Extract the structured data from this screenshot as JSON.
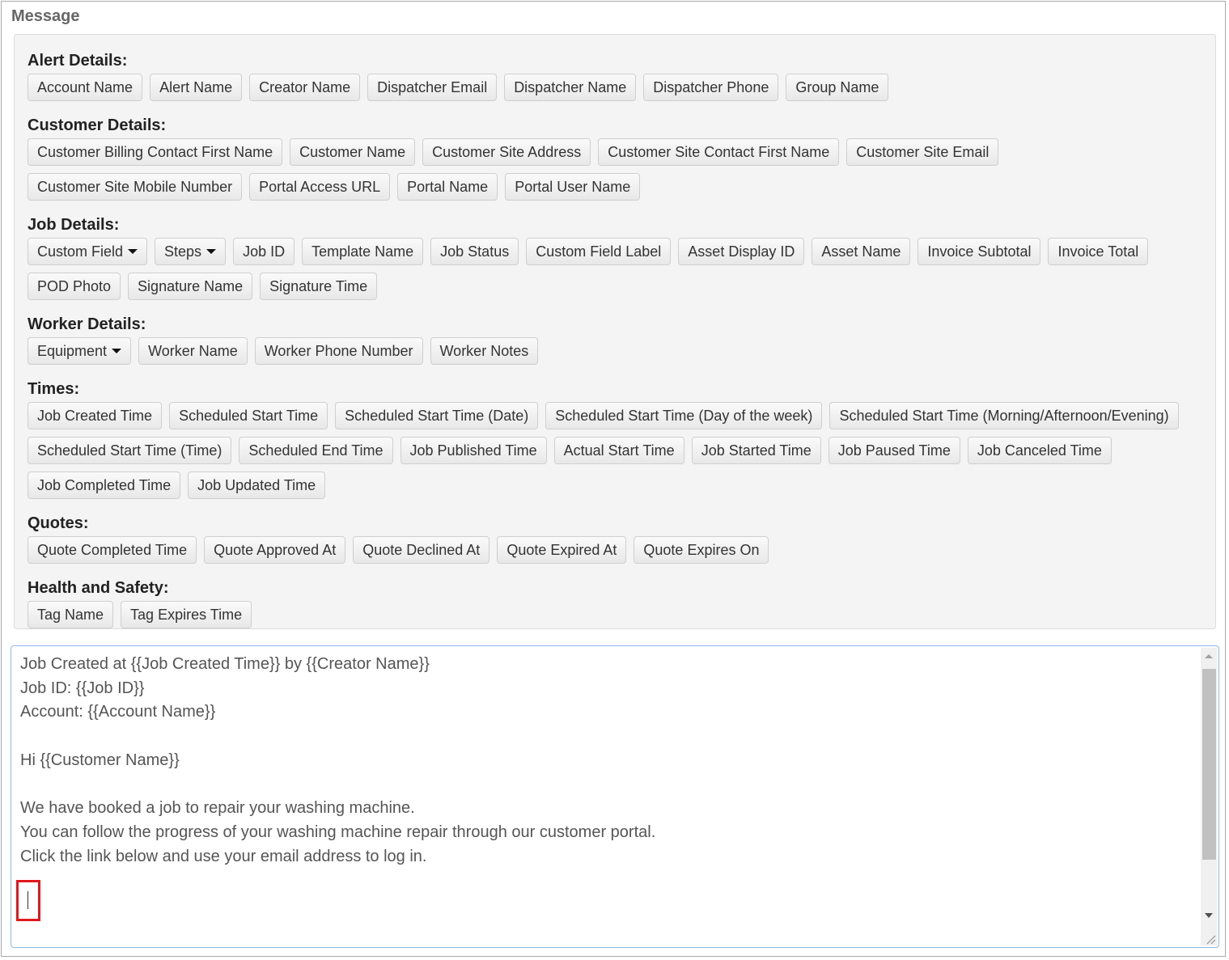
{
  "message_label": "Message",
  "sections": [
    {
      "title": "Alert Details:",
      "rows": [
        [
          {
            "label": "Account Name"
          },
          {
            "label": "Alert Name"
          },
          {
            "label": "Creator Name"
          },
          {
            "label": "Dispatcher Email"
          },
          {
            "label": "Dispatcher Name"
          },
          {
            "label": "Dispatcher Phone"
          },
          {
            "label": "Group Name"
          }
        ]
      ]
    },
    {
      "title": "Customer Details:",
      "rows": [
        [
          {
            "label": "Customer Billing Contact First Name"
          },
          {
            "label": "Customer Name"
          },
          {
            "label": "Customer Site Address"
          },
          {
            "label": "Customer Site Contact First Name"
          },
          {
            "label": "Customer Site Email"
          }
        ],
        [
          {
            "label": "Customer Site Mobile Number"
          },
          {
            "label": "Portal Access URL"
          },
          {
            "label": "Portal Name"
          },
          {
            "label": "Portal User Name"
          }
        ]
      ]
    },
    {
      "title": "Job Details:",
      "rows": [
        [
          {
            "label": "Custom Field",
            "dropdown": true
          },
          {
            "label": "Steps",
            "dropdown": true
          },
          {
            "label": "Job ID"
          },
          {
            "label": "Template Name"
          },
          {
            "label": "Job Status"
          },
          {
            "label": "Custom Field Label"
          },
          {
            "label": "Asset Display ID"
          },
          {
            "label": "Asset Name"
          },
          {
            "label": "Invoice Subtotal"
          },
          {
            "label": "Invoice Total"
          }
        ],
        [
          {
            "label": "POD Photo"
          },
          {
            "label": "Signature Name"
          },
          {
            "label": "Signature Time"
          }
        ]
      ]
    },
    {
      "title": "Worker Details:",
      "rows": [
        [
          {
            "label": "Equipment",
            "dropdown": true
          },
          {
            "label": "Worker Name"
          },
          {
            "label": "Worker Phone Number"
          },
          {
            "label": "Worker Notes"
          }
        ]
      ]
    },
    {
      "title": "Times:",
      "rows": [
        [
          {
            "label": "Job Created Time"
          },
          {
            "label": "Scheduled Start Time"
          },
          {
            "label": "Scheduled Start Time (Date)"
          },
          {
            "label": "Scheduled Start Time (Day of the week)"
          },
          {
            "label": "Scheduled Start Time (Morning/Afternoon/Evening)"
          }
        ],
        [
          {
            "label": "Scheduled Start Time (Time)"
          },
          {
            "label": "Scheduled End Time"
          },
          {
            "label": "Job Published Time"
          },
          {
            "label": "Actual Start Time"
          },
          {
            "label": "Job Started Time"
          },
          {
            "label": "Job Paused Time"
          },
          {
            "label": "Job Canceled Time"
          }
        ],
        [
          {
            "label": "Job Completed Time"
          },
          {
            "label": "Job Updated Time"
          }
        ]
      ]
    },
    {
      "title": "Quotes:",
      "rows": [
        [
          {
            "label": "Quote Completed Time"
          },
          {
            "label": "Quote Approved At"
          },
          {
            "label": "Quote Declined At"
          },
          {
            "label": "Quote Expired At"
          },
          {
            "label": "Quote Expires On"
          }
        ]
      ]
    },
    {
      "title": "Health and Safety:",
      "rows": [
        [
          {
            "label": "Tag Name"
          },
          {
            "label": "Tag Expires Time"
          }
        ]
      ]
    }
  ],
  "editor": {
    "value": "Job Created at {{Job Created Time}} by {{Creator Name}}\nJob ID: {{Job ID}}\nAccount: {{Account Name}}\n\nHi {{Customer Name}}\n\nWe have booked a job to repair your washing machine.\nYou can follow the progress of your washing machine repair through our customer portal.\nClick the link below and use your email address to log in.\n\n"
  },
  "colors": {
    "highlight": "#e0191f",
    "editor_border": "#8fb9e6",
    "panel_bg": "#f4f4f4"
  }
}
